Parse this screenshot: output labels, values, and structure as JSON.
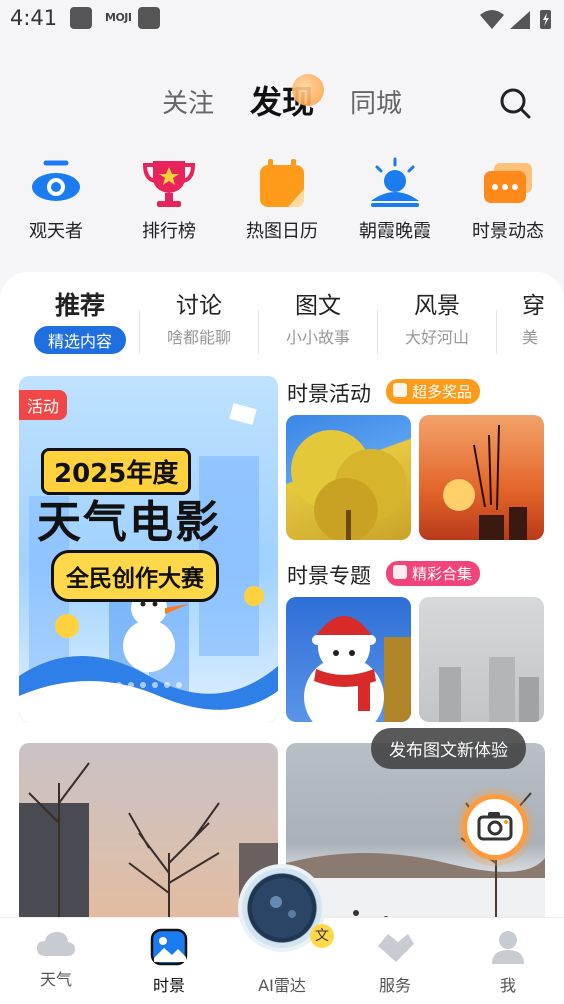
{
  "status": {
    "time": "4:41",
    "moji": "MOJI"
  },
  "top_tabs": [
    {
      "label": "关注"
    },
    {
      "label": "发现"
    },
    {
      "label": "同城"
    }
  ],
  "shortcuts": [
    {
      "label": "观天者",
      "icon": "eye-icon"
    },
    {
      "label": "排行榜",
      "icon": "trophy-icon"
    },
    {
      "label": "热图日历",
      "icon": "calendar-icon"
    },
    {
      "label": "朝霞晚霞",
      "icon": "sunrise-icon"
    },
    {
      "label": "时景动态",
      "icon": "feed-icon"
    }
  ],
  "categories": [
    {
      "title": "推荐",
      "sub": "精选内容"
    },
    {
      "title": "讨论",
      "sub": "啥都能聊"
    },
    {
      "title": "图文",
      "sub": "小小故事"
    },
    {
      "title": "风景",
      "sub": "大好河山"
    },
    {
      "title": "穿",
      "sub": "美"
    }
  ],
  "banner": {
    "badge": "活动",
    "year": "2025年度",
    "title": "天气电影",
    "subtitle": "全民创作大赛"
  },
  "section_activity": {
    "title": "时景活动",
    "badge": "超多奖品"
  },
  "section_topic": {
    "title": "时景专题",
    "badge": "精彩合集"
  },
  "tooltip": "发布图文新体验",
  "wen_badge": "文",
  "bottom_nav": [
    {
      "label": "天气"
    },
    {
      "label": "时景"
    },
    {
      "label": "AI雷达"
    },
    {
      "label": "服务"
    },
    {
      "label": "我"
    }
  ],
  "colors": {
    "accent": "#1f6fe0",
    "orange": "#ff9b3a",
    "pink": "#f0447a",
    "red": "#f04848"
  }
}
